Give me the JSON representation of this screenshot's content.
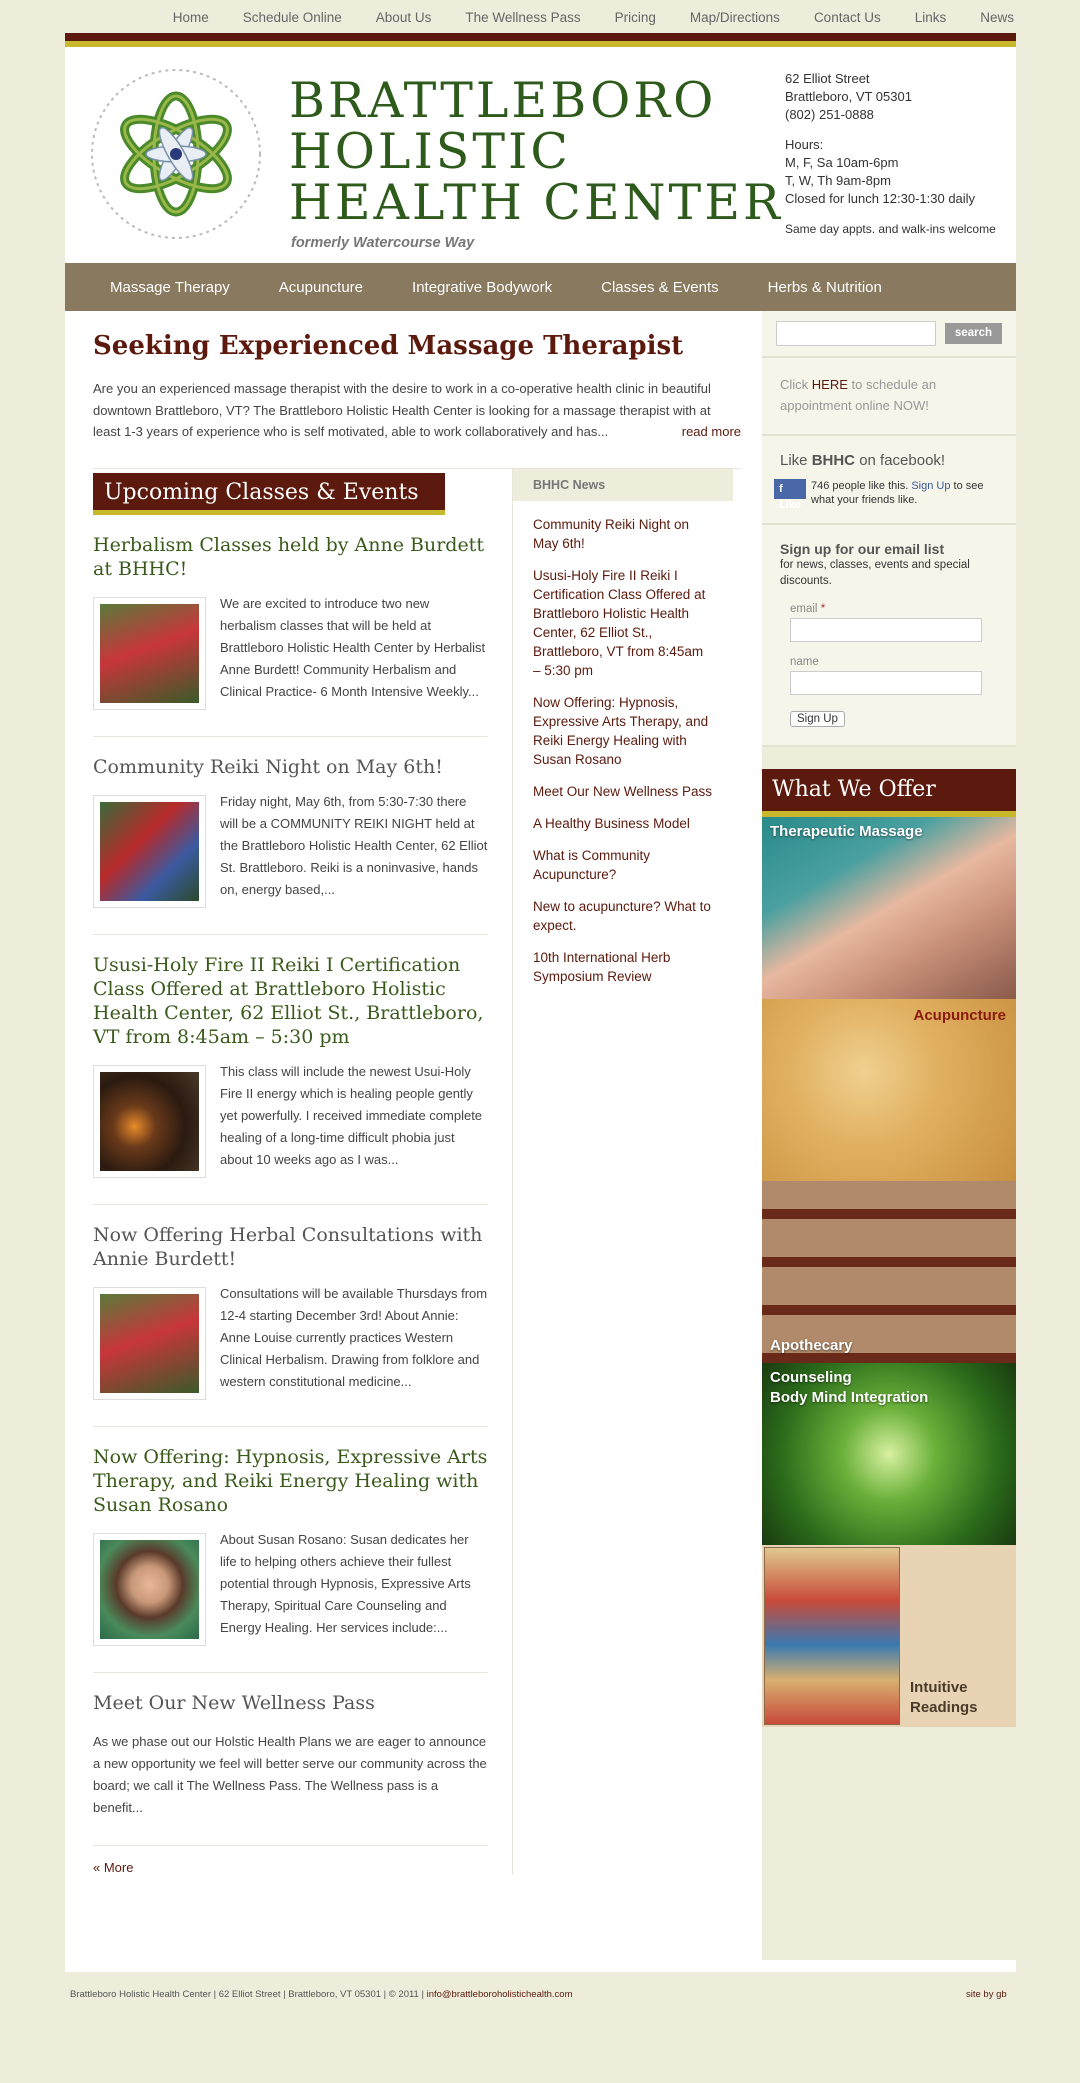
{
  "top_nav": [
    "Home",
    "Schedule Online",
    "About Us",
    "The Wellness Pass",
    "Pricing",
    "Map/Directions",
    "Contact Us",
    "Links",
    "News"
  ],
  "brand": {
    "line1": "BRATTLEBORO",
    "line2": "HOLISTIC",
    "line3": "HEALTH CENTER",
    "formerly": "formerly Watercourse Way"
  },
  "address": {
    "street": "62 Elliot Street",
    "city": "Brattleboro, VT 05301",
    "phone": "(802) 251-0888",
    "hours_label": "Hours:",
    "hours1": "M, F, Sa 10am-6pm",
    "hours2": "T, W, Th 9am-8pm",
    "lunch": "Closed for lunch 12:30-1:30 daily",
    "walkins": "Same day appts. and walk-ins welcome"
  },
  "main_nav": [
    "Massage Therapy",
    "Acupuncture",
    "Integrative Bodywork",
    "Classes & Events",
    "Herbs & Nutrition"
  ],
  "feature": {
    "title": "Seeking Experienced Massage Therapist",
    "text": "Are you an experienced massage therapist with the desire to work in a co-operative health clinic in beautiful downtown Brattleboro, VT? The Brattleboro Holistic Health Center is looking for a massage therapist with at least 1-3 years of experience who is self motivated, able to work collaboratively and has...",
    "more": "read more"
  },
  "events_heading": "Upcoming Classes & Events",
  "posts": [
    {
      "title": "Herbalism Classes held by Anne Burdett at BHHC!",
      "text": "We are excited to introduce two new herbalism classes that will be held at Brattleboro Holistic Health Center by Herbalist Anne Burdett! Community Herbalism and Clinical Practice- 6 Month Intensive Weekly..."
    },
    {
      "title": "Community Reiki Night on May 6th!",
      "text": "Friday night, May 6th, from 5:30-7:30 there will be a COMMUNITY REIKI NIGHT held at the Brattleboro Holistic Health Center, 62 Elliot St. Brattleboro.  Reiki is a noninvasive, hands on, energy based,..."
    },
    {
      "title": "Ususi-Holy Fire II Reiki I Certification Class Offered at Brattleboro Holistic Health Center, 62 Elliot St., Brattleboro, VT from 8:45am – 5:30 pm",
      "text": "This class will include the newest Usui-Holy Fire II energy which is healing people gently yet powerfully. I received immediate complete healing of a long-time difficult phobia just about 10 weeks ago as I was..."
    },
    {
      "title": "Now Offering Herbal Consultations with Annie Burdett!",
      "text": "Consultations will be available Thursdays from 12-4 starting December 3rd!  About Annie: Anne Louise currently practices Western Clinical Herbalism. Drawing from folklore and western constitutional medicine..."
    },
    {
      "title": "Now Offering: Hypnosis, Expressive Arts Therapy, and Reiki Energy Healing with Susan Rosano",
      "text": "About Susan Rosano: Susan dedicates her life to helping others achieve their fullest potential through Hypnosis, Expressive Arts Therapy, Spiritual Care Counseling and Energy Healing. Her services include:..."
    },
    {
      "title": "Meet Our New Wellness Pass",
      "text": "As we phase out our Holstic Health Plans we are eager to announce a new opportunity we feel will better serve our community across the board;  we call it  The Wellness Pass. The Wellness pass is a benefit..."
    }
  ],
  "more_link": "« More",
  "news": {
    "heading": "BHHC News",
    "items": [
      "Community Reiki Night on May 6th!",
      "Ususi-Holy Fire II Reiki I Certification Class Offered at Brattleboro Holistic Health Center, 62 Elliot St., Brattleboro, VT from 8:45am – 5:30 pm",
      "Now Offering: Hypnosis, Expressive Arts Therapy, and Reiki Energy Healing with Susan Rosano",
      "Meet Our New Wellness Pass",
      "A Healthy Business Model",
      "What is Community Acupuncture?",
      "New to acupuncture? What to expect.",
      "10th International Herb Symposium Review"
    ]
  },
  "sidebar": {
    "search_button": "search",
    "sched_pre": "Click ",
    "sched_link": "HERE",
    "sched_post": " to schedule an appointment online NOW!",
    "fb_pre": "Like ",
    "fb_bold": "BHHC",
    "fb_post": " on facebook!",
    "fb_button": "Like",
    "fb_count": "746 people like this.",
    "fb_signup": "Sign Up",
    "fb_rest": "to see what your friends like.",
    "email_title": "Sign up for our email list",
    "email_sub": "for news, classes, events and special discounts.",
    "email_label": "email",
    "email_req": "*",
    "name_label": "name",
    "signup_button": "Sign Up"
  },
  "offer": {
    "heading": "What We Offer",
    "tiles": [
      "Therapeutic Massage",
      "Acupuncture",
      "Apothecary",
      "Counseling",
      "Body Mind Integration",
      "Intuitive",
      "Readings"
    ]
  },
  "footer": {
    "text": "Brattleboro Holistic Health Center | 62 Elliot Street | Brattleboro, VT 05301 | © 2011 | ",
    "email": "info@brattleboroholistichealth.com",
    "credit": "site by gb"
  },
  "colors": {
    "brand_red": "#5b1a0d",
    "gold": "#c7b82c",
    "nav_tan": "#89795f",
    "brand_green": "#2e5a1c",
    "page_bg": "#eeeddc"
  }
}
